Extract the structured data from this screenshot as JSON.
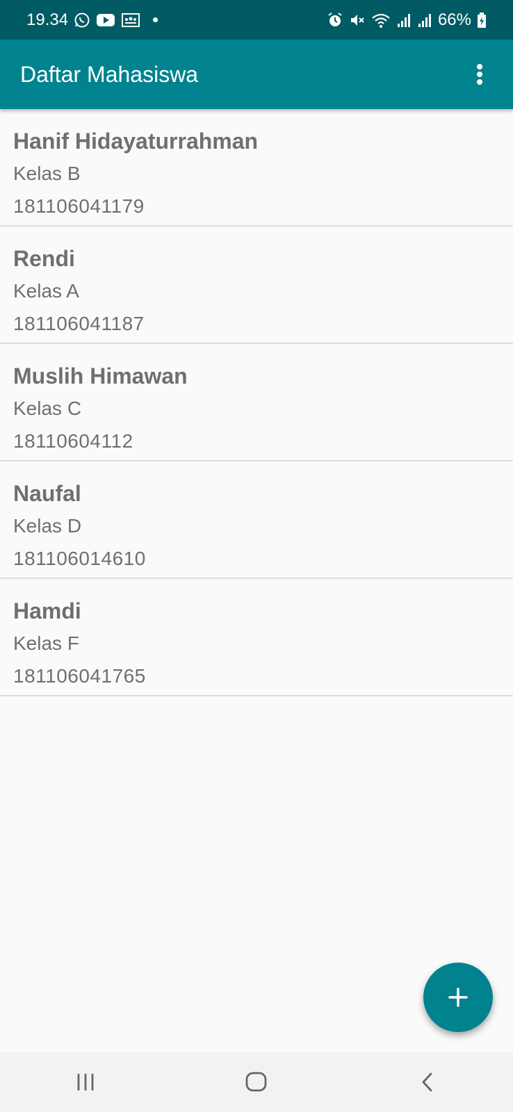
{
  "status_bar": {
    "time": "19.34",
    "battery": "66%",
    "icons_left": [
      "whatsapp-icon",
      "youtube-icon",
      "classroom-icon",
      "notification-dot"
    ],
    "icons_right": [
      "alarm-icon",
      "mute-icon",
      "wifi-icon",
      "signal-icon",
      "signal-icon",
      "battery-charging-icon"
    ]
  },
  "app_bar": {
    "title": "Daftar Mahasiswa",
    "menu_icon": "more-vert-icon"
  },
  "students": [
    {
      "name": "Hanif Hidayaturrahman",
      "kelas": "Kelas B",
      "nim": "181106041179"
    },
    {
      "name": "Rendi",
      "kelas": "Kelas A",
      "nim": "181106041187"
    },
    {
      "name": "Muslih Himawan",
      "kelas": "Kelas C",
      "nim": "18110604112"
    },
    {
      "name": "Naufal",
      "kelas": "Kelas D",
      "nim": "181106014610"
    },
    {
      "name": "Hamdi",
      "kelas": "Kelas F",
      "nim": "181106041765"
    }
  ],
  "fab": {
    "icon": "plus-icon"
  },
  "nav_bar": {
    "icons": [
      "recent-apps-icon",
      "home-icon",
      "back-icon"
    ]
  },
  "colors": {
    "status_bar": "#005b64",
    "app_bar": "#00838f",
    "fab": "#00838f",
    "text": "#6f6f6f",
    "background": "#fafafa"
  }
}
